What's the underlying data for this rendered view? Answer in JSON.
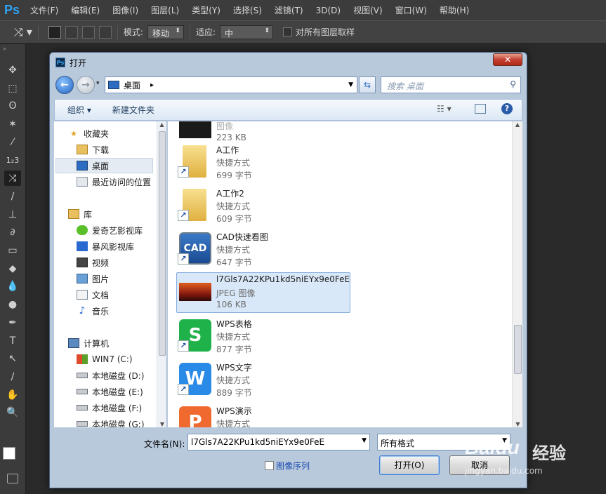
{
  "app": {
    "logo": "Ps"
  },
  "menu": [
    "文件(F)",
    "编辑(E)",
    "图像(I)",
    "图层(L)",
    "类型(Y)",
    "选择(S)",
    "滤镜(T)",
    "3D(D)",
    "视图(V)",
    "窗口(W)",
    "帮助(H)"
  ],
  "options": {
    "mode_label": "模式:",
    "mode_value": "移动",
    "adapt_label": "适应:",
    "adapt_value": "中",
    "sample_all_label": "对所有图层取样"
  },
  "tools": [
    "move-icon",
    "marquee-icon",
    "lasso-icon",
    "magic-wand-icon",
    "eyedropper-icon",
    "ruler-count-icon",
    "content-aware-move-icon",
    "brush-icon",
    "stamp-icon",
    "history-brush-icon",
    "eraser-icon",
    "paint-bucket-icon",
    "blur-icon",
    "dodge-icon",
    "pen-icon",
    "type-icon",
    "path-select-icon",
    "line-icon",
    "hand-icon",
    "zoom-icon"
  ],
  "tool_glyphs": [
    "✥",
    "⬚",
    "ʘ",
    "✶",
    "⁄",
    "1₂3",
    "⤨",
    "∕",
    "⊥",
    "∂",
    "▭",
    "◆",
    "💧",
    "●",
    "✒",
    "T",
    "↖",
    "∕",
    "✋",
    "🔍"
  ],
  "dialog": {
    "title": "打开",
    "close": "✕",
    "address": "桌面",
    "address_arrow": "▸",
    "search_placeholder": "搜索 桌面",
    "organize": "组织",
    "new_folder": "新建文件夹",
    "nav": {
      "favorites": "收藏夹",
      "downloads": "下载",
      "desktop": "桌面",
      "recent": "最近访问的位置",
      "library": "库",
      "iqiyi": "爱奇艺影视库",
      "storm": "暴风影视库",
      "video": "视频",
      "pictures": "图片",
      "documents": "文档",
      "music": "音乐",
      "computer": "计算机",
      "drive_c": "WIN7 (C:)",
      "drive_d": "本地磁盘 (D:)",
      "drive_e": "本地磁盘 (E:)",
      "drive_f": "本地磁盘 (F:)",
      "drive_g": "本地磁盘 (G:)"
    },
    "files": [
      {
        "name": "",
        "type": "图像",
        "size": "223 KB"
      },
      {
        "name": "A工作",
        "type": "快捷方式",
        "size": "699 字节"
      },
      {
        "name": "A工作2",
        "type": "快捷方式",
        "size": "609 字节"
      },
      {
        "name": "CAD快速看图",
        "type": "快捷方式",
        "size": "647 字节"
      },
      {
        "name": "l7Gls7A22KPu1kd5niEYx9e0FeE",
        "type": "JPEG 图像",
        "size": "106 KB"
      },
      {
        "name": "WPS表格",
        "type": "快捷方式",
        "size": "877 字节"
      },
      {
        "name": "WPS文字",
        "type": "快捷方式",
        "size": "889 字节"
      },
      {
        "name": "WPS演示",
        "type": "快捷方式",
        "size": ""
      }
    ],
    "filename_label": "文件名(N):",
    "filename_value": "l7Gls7A22KPu1kd5niEYx9e0FeE",
    "format_value": "所有格式",
    "image_sequence": "图像序列",
    "open_button": "打开(O)",
    "cancel_button": "取消"
  },
  "watermark": {
    "brand": "Baidu",
    "brand2": "经验",
    "url": "jingyan.baidu.com"
  }
}
